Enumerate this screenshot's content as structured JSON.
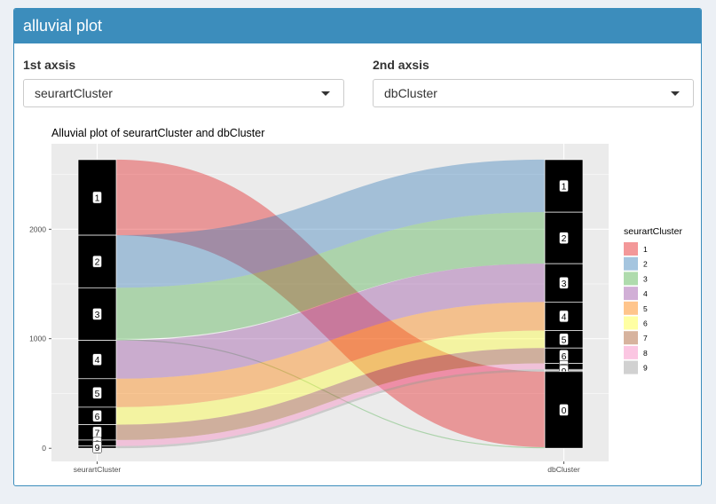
{
  "box": {
    "title": "alluvial plot"
  },
  "controls": {
    "axis1": {
      "label": "1st axsis",
      "value": "seurartCluster"
    },
    "axis2": {
      "label": "2nd axsis",
      "value": "dbCluster"
    }
  },
  "chart_data": {
    "type": "alluvial",
    "title": "Alluvial plot of  seurartCluster and dbCluster",
    "axes": [
      "seurartCluster",
      "dbCluster"
    ],
    "ylim": [
      -120,
      2780
    ],
    "yticks": [
      0,
      1000,
      2000
    ],
    "grid": true,
    "legend": {
      "title": "seurartCluster",
      "position": "right"
    },
    "colors": {
      "1": "#e41a1c",
      "2": "#377eb8",
      "3": "#4daf4a",
      "4": "#984ea3",
      "5": "#ff7f00",
      "6": "#ffff33",
      "7": "#a65628",
      "8": "#f781bf",
      "9": "#999999"
    },
    "axis1_strata": [
      {
        "label": "1",
        "size": 690
      },
      {
        "label": "2",
        "size": 480
      },
      {
        "label": "3",
        "size": 480
      },
      {
        "label": "4",
        "size": 350
      },
      {
        "label": "5",
        "size": 260
      },
      {
        "label": "6",
        "size": 160
      },
      {
        "label": "7",
        "size": 140
      },
      {
        "label": "8",
        "size": 55
      },
      {
        "label": "9",
        "size": 20
      }
    ],
    "axis2_strata": [
      {
        "label": "1",
        "size": 480
      },
      {
        "label": "2",
        "size": 470
      },
      {
        "label": "3",
        "size": 350
      },
      {
        "label": "4",
        "size": 260
      },
      {
        "label": "5",
        "size": 160
      },
      {
        "label": "6",
        "size": 140
      },
      {
        "label": "7",
        "size": 55
      },
      {
        "label": "8",
        "size": 10
      },
      {
        "label": "9",
        "size": 10
      },
      {
        "label": "0",
        "size": 700
      }
    ],
    "flows": [
      {
        "from": "1",
        "to": "0",
        "value": 690
      },
      {
        "from": "2",
        "to": "1",
        "value": 480
      },
      {
        "from": "3",
        "to": "2",
        "value": 470
      },
      {
        "from": "3",
        "to": "0",
        "value": 10
      },
      {
        "from": "4",
        "to": "3",
        "value": 350
      },
      {
        "from": "5",
        "to": "4",
        "value": 260
      },
      {
        "from": "6",
        "to": "5",
        "value": 160
      },
      {
        "from": "7",
        "to": "6",
        "value": 140
      },
      {
        "from": "8",
        "to": "7",
        "value": 55
      },
      {
        "from": "9",
        "to": "8",
        "value": 10
      },
      {
        "from": "9",
        "to": "9",
        "value": 10
      }
    ]
  }
}
